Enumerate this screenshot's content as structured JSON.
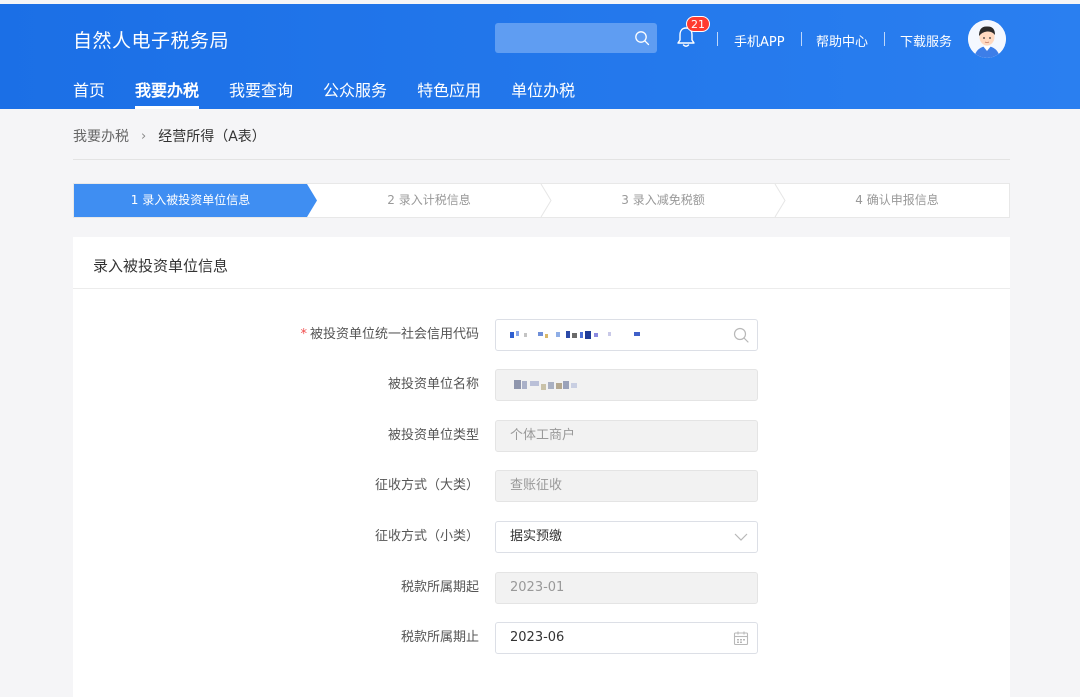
{
  "header": {
    "title": "自然人电子税务局",
    "search_placeholder": "",
    "notification_count": "21",
    "links": [
      "手机APP",
      "帮助中心",
      "下载服务"
    ]
  },
  "nav": {
    "items": [
      "首页",
      "我要办税",
      "我要查询",
      "公众服务",
      "特色应用",
      "单位办税"
    ],
    "active": "我要办税"
  },
  "breadcrumb": {
    "parent": "我要办税",
    "separator": "›",
    "current": "经营所得（A表）"
  },
  "steps": [
    {
      "label": "1  录入被投资单位信息",
      "active": true
    },
    {
      "label": "2  录入计税信息",
      "active": false
    },
    {
      "label": "3  录入减免税额",
      "active": false
    },
    {
      "label": "4  确认申报信息",
      "active": false
    }
  ],
  "panel": {
    "title": "录入被投资单位信息"
  },
  "form": {
    "credit_code": {
      "label": "被投资单位统一社会信用代码",
      "required": "*"
    },
    "unit_name": {
      "label": "被投资单位名称"
    },
    "unit_type": {
      "label": "被投资单位类型",
      "value": "个体工商户"
    },
    "levy_major": {
      "label": "征收方式（大类）",
      "value": "查账征收"
    },
    "levy_minor": {
      "label": "征收方式（小类）",
      "value": "据实预缴"
    },
    "period_start": {
      "label": "税款所属期起",
      "value": "2023-01"
    },
    "period_end": {
      "label": "税款所属期止",
      "value": "2023-06"
    }
  },
  "colors": {
    "primary": "#1b6fe6",
    "step_active": "#3f8ef2",
    "required": "#f04b4b",
    "badge": "#ff3b30"
  },
  "icons": [
    "search-icon",
    "bell-icon",
    "avatar",
    "chevron-down-icon",
    "calendar-icon"
  ]
}
